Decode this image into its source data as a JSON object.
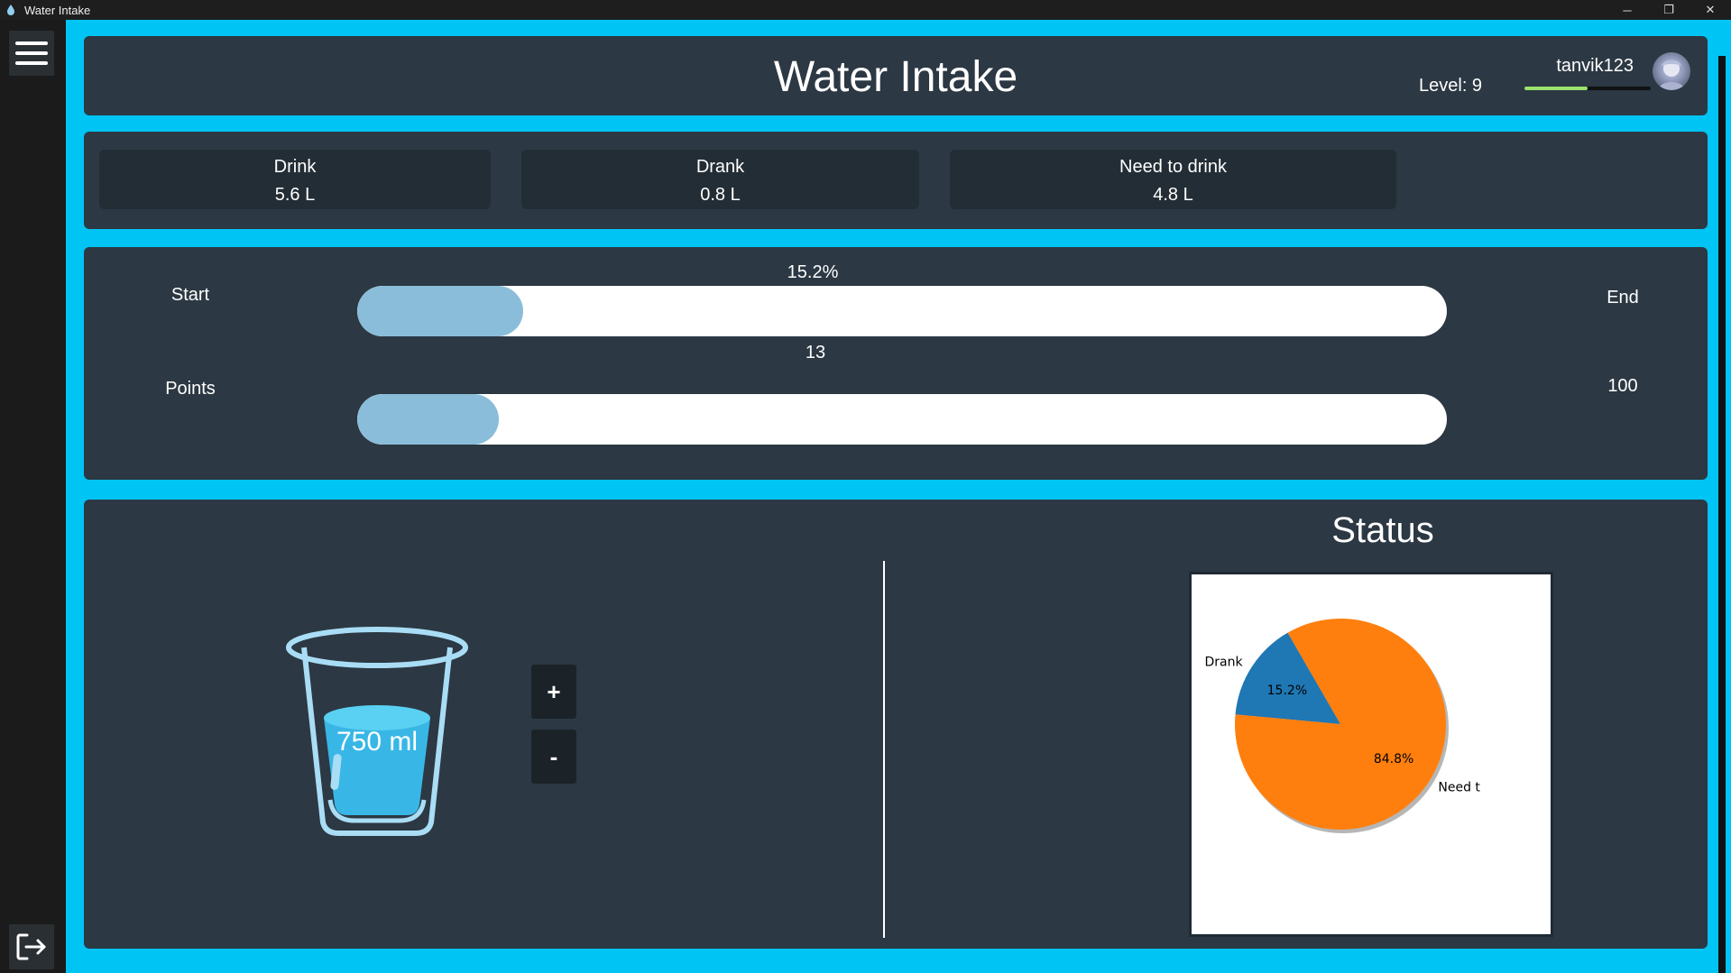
{
  "window": {
    "title": "Water Intake",
    "minimize": "─",
    "maximize": "❐",
    "close": "✕"
  },
  "header": {
    "title": "Water Intake",
    "username": "tanvik123",
    "level_label": "Level: 9",
    "level_progress": 0.5
  },
  "stats": [
    {
      "label": "Drink",
      "value": "5.6 L"
    },
    {
      "label": "Drank",
      "value": "0.8 L"
    },
    {
      "label": "Need to drink",
      "value": "4.8 L"
    }
  ],
  "progress": {
    "intake": {
      "left_label": "Start",
      "right_label": "End",
      "caption": "15.2%",
      "fraction": 0.152
    },
    "points": {
      "left_label": "Points",
      "right_label": "100",
      "caption": "13",
      "fraction": 0.13
    }
  },
  "glass": {
    "amount": "750 ml",
    "plus_label": "+",
    "minus_label": "-"
  },
  "status": {
    "title": "Status",
    "chart_data": {
      "type": "pie",
      "slices": [
        {
          "label": "Drank",
          "value": 15.2,
          "pct_label": "15.2%",
          "color": "#1f77b4"
        },
        {
          "label": "Need to drink",
          "value": 84.8,
          "pct_label": "84.8%",
          "color": "#ff7f0e"
        }
      ],
      "shadow": true,
      "visible_label_text": {
        "drank": "Drank",
        "need": "Need t"
      }
    }
  },
  "colors": {
    "accent": "#00c4f4",
    "panel": "#2c3843",
    "card": "#232d35",
    "bar_fill": "#8abdd9",
    "level": "#9be36e"
  }
}
